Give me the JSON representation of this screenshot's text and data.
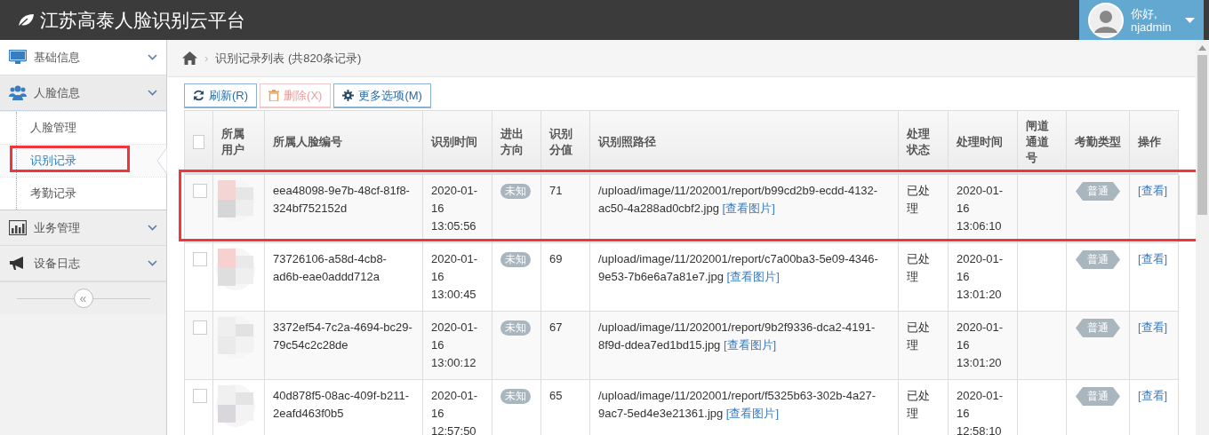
{
  "header": {
    "logo_text": "江苏高泰人脸识别云平台",
    "greeting": "你好,",
    "username": "njadmin"
  },
  "sidebar": {
    "groups": [
      {
        "label": "基础信息",
        "expanded": false
      },
      {
        "label": "人脸信息",
        "expanded": true,
        "children": [
          {
            "label": "人脸管理",
            "selected": false,
            "highlighted": false
          },
          {
            "label": "识别记录",
            "selected": true,
            "highlighted": true
          },
          {
            "label": "考勤记录",
            "selected": false,
            "highlighted": false
          }
        ]
      },
      {
        "label": "业务管理",
        "expanded": false
      },
      {
        "label": "设备日志",
        "expanded": false
      }
    ],
    "collapse_button": "«"
  },
  "breadcrumb": {
    "separator": "›",
    "title": "识别记录列表 (共820条记录)"
  },
  "toolbar": [
    {
      "label": "刷新(R)",
      "disabled": false
    },
    {
      "label": "删除(X)",
      "disabled": true
    },
    {
      "label": "更多选项(M)",
      "disabled": false
    }
  ],
  "table": {
    "header_checked": false,
    "columns": [
      "所属用户",
      "所属人脸编号",
      "识别时间",
      "进出方向",
      "识别分值",
      "识别照路径",
      "处理状态",
      "处理时间",
      "闸道通道号",
      "考勤类型",
      "操作"
    ],
    "rows": [
      {
        "checked": false,
        "highlighted": true,
        "face_id": "eea48098-9e7b-48cf-81f8-324bf752152d",
        "time": "2020-01-16 13:05:56",
        "direction": "未知",
        "score": "71",
        "path": "/upload/image/11/202001/report/b99cd2b9-ecdd-4132-ac50-4a288ad0cbf2.jpg",
        "path_link": "[查看图片]",
        "status": "已处理",
        "processed_time": "2020-01-16 13:06:10",
        "type": "普通",
        "action": "[查看]"
      },
      {
        "checked": false,
        "highlighted": false,
        "face_id": "73726106-a58d-4cb8-ad6b-eae0addd712a",
        "time": "2020-01-16 13:00:45",
        "direction": "未知",
        "score": "69",
        "path": "/upload/image/11/202001/report/c7a00ba3-5e09-4346-9e53-7b6e6a7a81e7.jpg",
        "path_link": "[查看图片]",
        "status": "已处理",
        "processed_time": "2020-01-16 13:01:20",
        "type": "普通",
        "action": "[查看]"
      },
      {
        "checked": false,
        "highlighted": false,
        "face_id": "3372ef54-7c2a-4694-bc29-79c54c2c28de",
        "time": "2020-01-16 13:00:12",
        "direction": "未知",
        "score": "67",
        "path": "/upload/image/11/202001/report/9b2f9336-dca2-4191-8f9d-ddea7ed1bd15.jpg",
        "path_link": "[查看图片]",
        "status": "已处理",
        "processed_time": "2020-01-16 13:01:20",
        "type": "普通",
        "action": "[查看]"
      },
      {
        "checked": false,
        "highlighted": false,
        "face_id": "40d878f5-08ac-409f-b211-2eafd463f0b5",
        "time": "2020-01-16 12:57:50",
        "direction": "未知",
        "score": "65",
        "path": "/upload/image/11/202001/report/f5325b63-302b-4a27-9ac7-5ed4e3e21361.jpg",
        "path_link": "[查看图片]",
        "status": "已处理",
        "processed_time": "2020-01-16 12:58:10",
        "type": "普通",
        "action": "[查看]"
      }
    ]
  }
}
